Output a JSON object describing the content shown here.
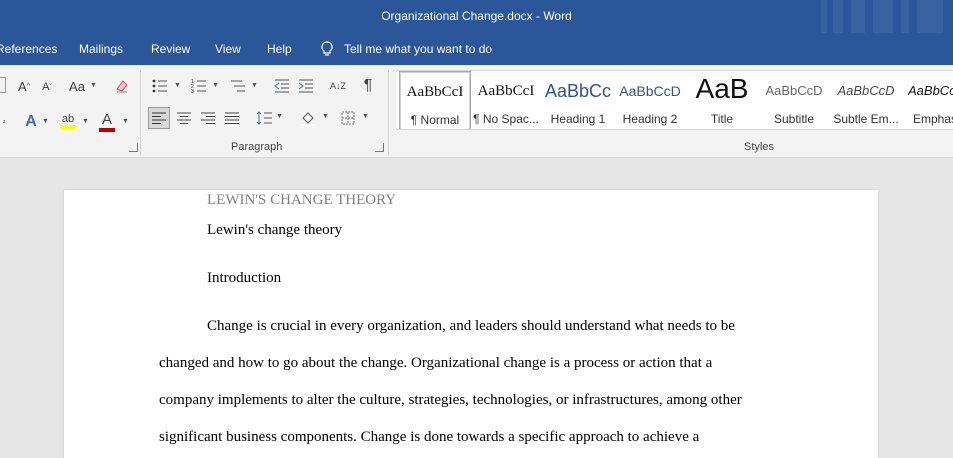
{
  "window": {
    "title": "Organizational Change.docx  -  Word"
  },
  "tabs": [
    "References",
    "Mailings",
    "Review",
    "View",
    "Help"
  ],
  "tell_me": "Tell me what you want to do",
  "ribbon": {
    "paragraph_label": "Paragraph",
    "styles_label": "Styles",
    "font_size_label": "Aa",
    "grow_font": "A",
    "shrink_font": "A",
    "pilcrow": "¶",
    "sort": "A↓Z",
    "font_color_glyph": "A",
    "text_effects_glyph": "A",
    "highlight_glyph": "ab"
  },
  "styles": [
    {
      "sample": "AaBbCcI",
      "label": "¶ Normal",
      "selected": true
    },
    {
      "sample": "AaBbCcI",
      "label": "¶ No Spac..."
    },
    {
      "sample": "AaBbCc",
      "label": "Heading 1"
    },
    {
      "sample": "AaBbCcD",
      "label": "Heading 2"
    },
    {
      "sample": "AaB",
      "label": "Title"
    },
    {
      "sample": "AaBbCcD",
      "label": "Subtitle"
    },
    {
      "sample": "AaBbCcD",
      "label": "Subtle Em..."
    },
    {
      "sample": "AaBbCc",
      "label": "Emphas"
    }
  ],
  "colors": {
    "brand_blue": "#2b579a",
    "highlight_yellow": "#ffff00",
    "font_color_red": "#c00000"
  },
  "document": {
    "running_head": "LEWIN'S CHANGE THEORY",
    "title_line": "Lewin's change theory",
    "heading": "Introduction",
    "body_lines": [
      "Change is crucial in every organization, and leaders should understand what needs to be",
      "changed and how to go about the change. Organizational change is a process or action that a",
      "company implements to alter the culture, strategies, technologies, or infrastructures, among other",
      "significant business components. Change is done towards a specific approach to achieve a"
    ]
  }
}
